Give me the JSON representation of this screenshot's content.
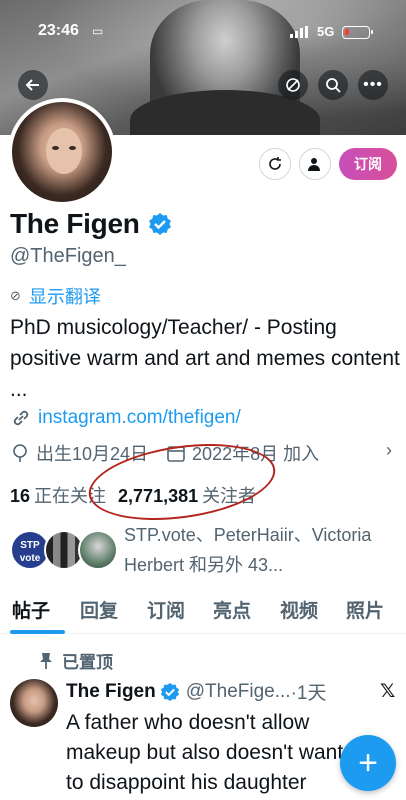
{
  "status_bar": {
    "time": "23:46",
    "network": "5G"
  },
  "profile": {
    "display_name": "The Figen",
    "handle": "@TheFigen_",
    "translate_label": "显示翻译",
    "bio": "PhD musicology/Teacher/ - Posting positive warm and art and memes content ...",
    "link": "instagram.com/thefigen/",
    "birthday": "出生10月24日",
    "joined": "2022年8月 加入",
    "subscribe_label": "订阅"
  },
  "stats": {
    "following_count": "16",
    "following_label": "正在关注",
    "followers_count": "2,771,381",
    "followers_label": "关注者"
  },
  "followers_preview": {
    "stp_badge": "STP vote",
    "text": "STP.vote、PeterHaiir、Victoria Herbert 和另外 43..."
  },
  "tabs": [
    "帖子",
    "回复",
    "订阅",
    "亮点",
    "视频",
    "照片"
  ],
  "pinned_post": {
    "pinned_label": "已置顶",
    "author_name": "The Figen",
    "author_handle": "@TheFige...",
    "time": "·1天",
    "text": "A father who doesn't allow makeup but also doesn't want to disappoint his daughter"
  },
  "icons": {
    "back": "back-arrow-icon",
    "repost_top": "repost-icon",
    "search": "search-icon",
    "more": "more-icon",
    "verified": "verified-badge-icon",
    "link": "link-icon",
    "location": "location-icon",
    "calendar": "calendar-icon",
    "pin": "pin-icon",
    "x_logo": "x-logo-icon",
    "compose": "plus-icon"
  },
  "colors": {
    "accent": "#1d9bf0",
    "subscribe": "#d94f9a",
    "annotation": "#b3261e"
  }
}
